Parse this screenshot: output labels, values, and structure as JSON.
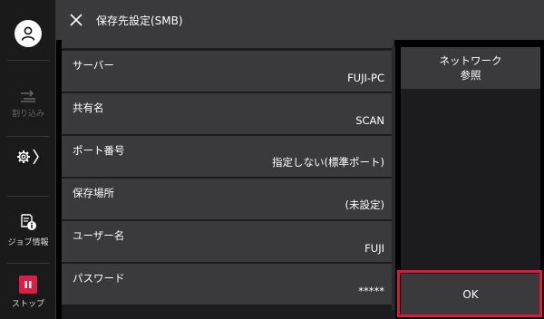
{
  "rail": {
    "interrupt_label": "割り込み",
    "job_info_label": "ジョブ情報",
    "stop_label": "ストップ"
  },
  "header": {
    "title": "保存先設定(SMB)"
  },
  "list": {
    "rows": [
      {
        "label": "サーバー",
        "value": "FUJI-PC"
      },
      {
        "label": "共有名",
        "value": "SCAN"
      },
      {
        "label": "ポート番号",
        "value": "指定しない(標準ポート)"
      },
      {
        "label": "保存場所",
        "value": "(未設定)"
      },
      {
        "label": "ユーザー名",
        "value": "FUJI"
      },
      {
        "label": "パスワード",
        "value": "*****"
      }
    ]
  },
  "panel": {
    "network_line1": "ネットワーク",
    "network_line2": "参照",
    "ok_label": "OK"
  },
  "colors": {
    "stop_red": "#d6204a",
    "highlight_red": "#d81b3c",
    "row_bg": "#3a3a3c"
  }
}
